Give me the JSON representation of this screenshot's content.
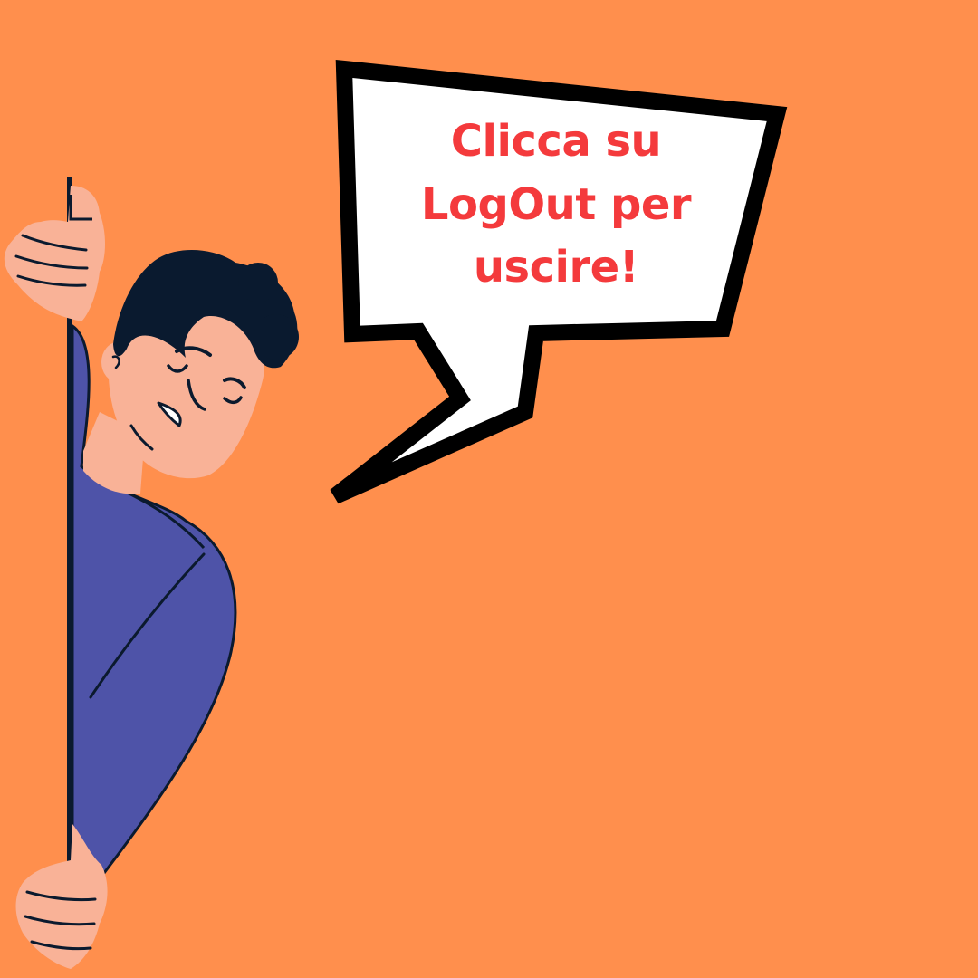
{
  "background_color": "#ff8f4d",
  "speech_bubble": {
    "lines": [
      "Clicca su",
      "LogOut per",
      "uscire!"
    ],
    "text_color": "#f43a3c",
    "fill_color": "#ffffff",
    "outline_color": "#000000"
  },
  "character": {
    "icons": [
      "person-peeking-icon",
      "hand-icon",
      "wink-face-icon"
    ],
    "shirt_color": "#4e53a8",
    "skin_color": "#f9b297",
    "hair_color": "#0a1a2f"
  }
}
